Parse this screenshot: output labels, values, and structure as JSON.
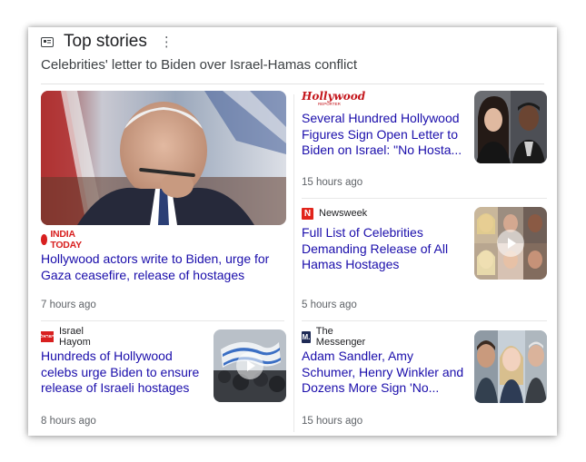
{
  "header": {
    "title": "Top stories",
    "subtitle": "Celebrities' letter to Biden over Israel-Hamas conflict"
  },
  "stories": [
    {
      "source": "INDIA TODAY",
      "headline": "Hollywood actors write to Biden, urge for Gaza ceasefire, release of hostages",
      "time": "7 hours ago"
    },
    {
      "source": "Hollywood Reporter",
      "headline": "Several Hundred Hollywood Figures Sign Open Letter to Biden on Israel: \"No Hosta...",
      "time": "15 hours ago"
    },
    {
      "source": "Newsweek",
      "headline": "Full List of Celebrities Demanding Release of All Hamas Hostages",
      "time": "5 hours ago"
    },
    {
      "source": "Israel Hayom",
      "headline": "Hundreds of Hollywood celebs urge Biden to ensure release of Israeli hostages",
      "time": "8 hours ago"
    },
    {
      "source": "The Messenger",
      "headline": "Adam Sandler, Amy Schumer, Henry Winkler and Dozens More Sign 'No...",
      "time": "15 hours ago"
    }
  ],
  "logos": {
    "hollywood_reporter_line1": "Hollywood",
    "hollywood_reporter_line2": "REPORTER",
    "newsweek_letter": "N",
    "messenger_letter": "M.",
    "israel_hayom_mark": "ישראל"
  },
  "icons": {
    "header": "news-icon",
    "menu": "more-vert-icon",
    "video": "play-icon"
  },
  "colors": {
    "headline_link": "#1a0dab",
    "india_today_red": "#d8201f",
    "hollywood_reporter_red": "#c4161c",
    "newsweek_red": "#e1241b",
    "messenger_navy": "#1e2a55",
    "timestamp_gray": "#5f6368"
  }
}
